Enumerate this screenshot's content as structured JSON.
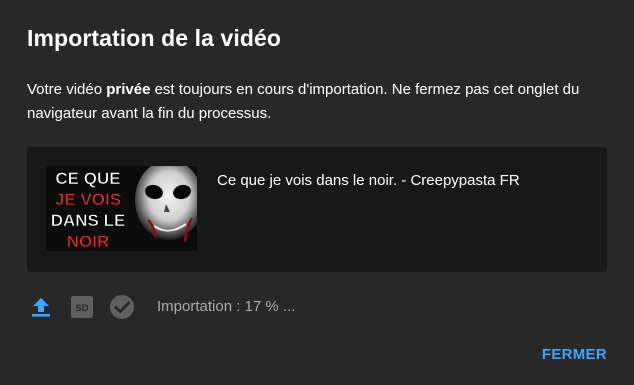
{
  "dialog": {
    "title": "Importation de la vidéo",
    "message_prefix": "Votre vidéo ",
    "message_bold": "privée",
    "message_suffix": " est toujours en cours d'importation. Ne fermez pas cet onglet du navigateur avant la fin du processus.",
    "close_label": "FERMER"
  },
  "video": {
    "title": "Ce que je vois dans le noir. - Creepypasta FR",
    "thumbnail_text": [
      "CE QUE",
      "JE VOIS",
      "DANS LE",
      "NOIR"
    ]
  },
  "status": {
    "text": "Importation : 17 % ...",
    "progress_percent": 17,
    "icons": [
      "upload-icon",
      "sd-icon",
      "check-circle-icon"
    ]
  },
  "colors": {
    "background": "#282828",
    "card": "#181818",
    "accent": "#3ea6ff",
    "muted": "#aaaaaa",
    "thumb_red": "#e52b1f"
  }
}
